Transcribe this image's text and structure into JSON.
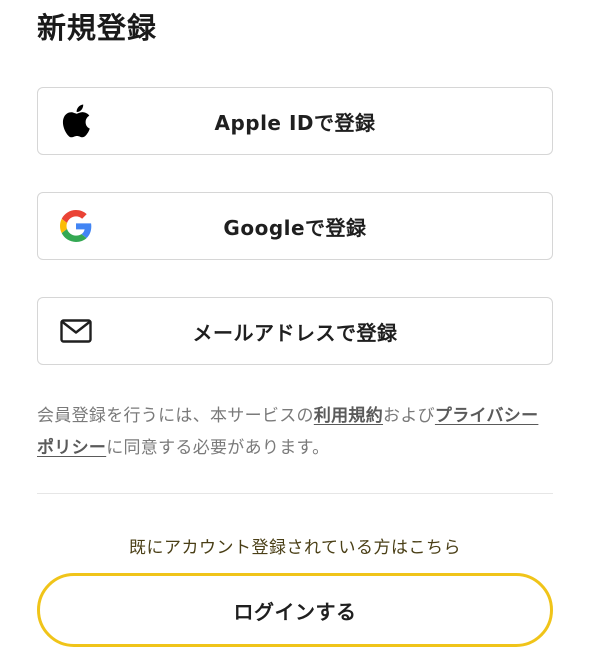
{
  "page": {
    "title": "新規登録"
  },
  "signup_options": [
    {
      "label": "Apple IDで登録",
      "icon": "apple-icon"
    },
    {
      "label": "Googleで登録",
      "icon": "google-icon"
    },
    {
      "label": "メールアドレスで登録",
      "icon": "mail-icon"
    }
  ],
  "terms": {
    "prefix": "会員登録を行うには、本サービスの",
    "terms_link": "利用規約",
    "middle": "および",
    "privacy_link": "プライバシーポリシー",
    "suffix": "に同意する必要があります。"
  },
  "login": {
    "prompt": "既にアカウント登録されている方はこちら",
    "button_label": "ログインする"
  },
  "colors": {
    "accent": "#f0c419",
    "google_blue": "#4285F4",
    "google_red": "#EA4335",
    "google_yellow": "#FBBC05",
    "google_green": "#34A853"
  }
}
